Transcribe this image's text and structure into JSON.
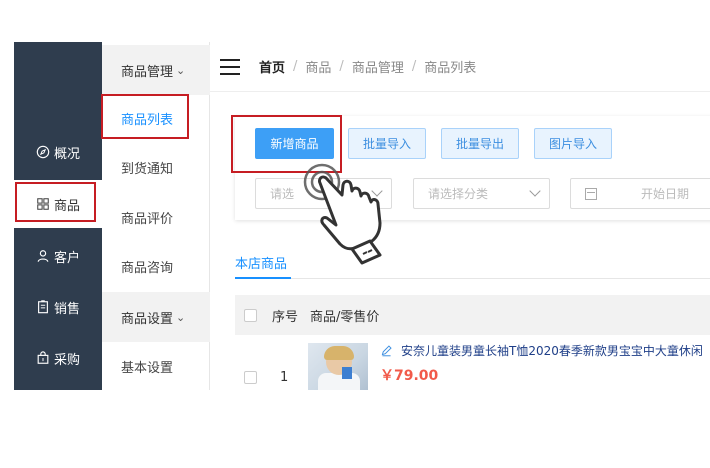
{
  "sidebar": {
    "items": [
      {
        "label": "概况",
        "icon": "compass-icon"
      },
      {
        "label": "商品",
        "icon": "grid-icon"
      },
      {
        "label": "客户",
        "icon": "user-icon"
      },
      {
        "label": "销售",
        "icon": "document-icon"
      },
      {
        "label": "采购",
        "icon": "bag-icon"
      }
    ],
    "active_index": 1
  },
  "subnav": {
    "group1": "商品管理",
    "items1": [
      "商品列表",
      "到货通知",
      "商品评价",
      "商品咨询"
    ],
    "group2": "商品设置",
    "items2": [
      "基本设置"
    ],
    "active": "商品列表"
  },
  "breadcrumb": [
    "首页",
    "商品",
    "商品管理",
    "商品列表"
  ],
  "buttons": {
    "add": "新增商品",
    "batch_import": "批量导入",
    "batch_export": "批量导出",
    "image_import": "图片导入"
  },
  "filters": {
    "select1_placeholder": "请选",
    "select2_placeholder": "请选择分类",
    "date_placeholder": "开始日期"
  },
  "tabs": [
    "本店商品"
  ],
  "table": {
    "headers": [
      "序号",
      "商品/零售价"
    ],
    "rows": [
      {
        "index": "1",
        "name": "安奈儿童装男童长袖T恤2020春季新款男宝宝中大童休闲",
        "price": "￥79.00"
      }
    ]
  },
  "colors": {
    "sidebar": "#2f3d4e",
    "primary": "#3d9ff6",
    "price": "#f15a4a",
    "highlight": "#c61d23"
  }
}
